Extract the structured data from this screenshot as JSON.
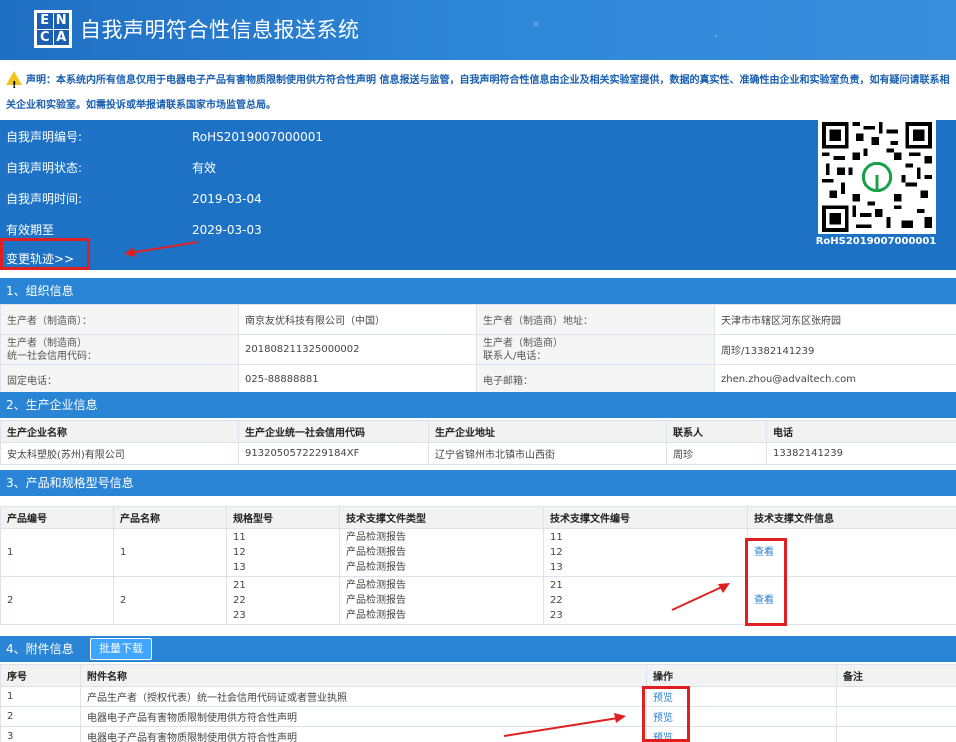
{
  "header": {
    "logo_letters": [
      "E",
      "N",
      "C",
      "A"
    ],
    "title": "自我声明符合性信息报送系统"
  },
  "notice": {
    "text": "声明：本系统内所有信息仅用于电器电子产品有害物质限制使用供方符合性声明 信息报送与监管，自我声明符合性信息由企业及相关实验室提供，数据的真实性、准确性由企业和实验室负责，如有疑问请联系相关企业和实验室。如需投诉或举报请联系国家市场监管总局。"
  },
  "declaration": {
    "rows": [
      {
        "label": "自我声明编号:",
        "value": "RoHS2019007000001"
      },
      {
        "label": "自我声明状态:",
        "value": "有效"
      },
      {
        "label": "自我声明时间:",
        "value": "2019-03-04"
      },
      {
        "label": "有效期至",
        "value": "2029-03-03"
      }
    ],
    "track_link": "变更轨迹>>",
    "qr_label": "RoHS2019007000001"
  },
  "sections": {
    "org": "1、组织信息",
    "ent": "2、生产企业信息",
    "prod": "3、产品和规格型号信息",
    "att": "4、附件信息",
    "batch_download": "批量下载"
  },
  "org": {
    "rows": [
      [
        "生产者（制造商）：",
        "南京友优科技有限公司（中国）",
        "生产者（制造商）地址：",
        "天津市市辖区河东区张府园"
      ],
      [
        "生产者（制造商）\n统一社会信用代码：",
        "201808211325000002",
        "生产者（制造商）\n联系人/电话：",
        "周珍/13382141239"
      ],
      [
        "固定电话：",
        "025-88888881",
        "电子邮箱：",
        "zhen.zhou@advaltech.com"
      ]
    ]
  },
  "enterprise": {
    "headers": [
      "生产企业名称",
      "生产企业统一社会信用代码",
      "生产企业地址",
      "联系人",
      "电话"
    ],
    "rows": [
      [
        "安太科塑胶(苏州)有限公司",
        "913205057222918​4XF",
        "辽宁省锦州市北镇市山西街",
        "周珍",
        "13382141239"
      ]
    ]
  },
  "products": {
    "headers": [
      "产品编号",
      "产品名称",
      "规格型号",
      "技术支撑文件类型",
      "技术支撑文件编号",
      "技术支撑文件信息"
    ],
    "rows": [
      {
        "no": "1",
        "name": "1",
        "models": [
          "11",
          "12",
          "13"
        ],
        "types": [
          "产品检测报告",
          "产品检测报告",
          "产品检测报告"
        ],
        "codes": [
          "11",
          "12",
          "13"
        ],
        "action": "查看"
      },
      {
        "no": "2",
        "name": "2",
        "models": [
          "21",
          "22",
          "23"
        ],
        "types": [
          "产品检测报告",
          "产品检测报告",
          "产品检测报告"
        ],
        "codes": [
          "21",
          "22",
          "23"
        ],
        "action": "查看"
      }
    ]
  },
  "attachments": {
    "headers": [
      "序号",
      "附件名称",
      "操作",
      "备注"
    ],
    "rows": [
      {
        "no": "1",
        "name": "产品生产者（授权代表）统一社会信用代码证或者营业执照",
        "action": "预览"
      },
      {
        "no": "2",
        "name": "电器电子产品有害物质限制使用供方符合性声明",
        "action": "预览"
      },
      {
        "no": "3",
        "name": "电器电子产品有害物质限制使用供方符合性声明",
        "action": "预览"
      }
    ]
  },
  "colors": {
    "header_blue": "#1f6fc2",
    "section_blue": "#2a85d6",
    "annotation_red": "#e02020",
    "link_blue": "#2a7fd4"
  }
}
